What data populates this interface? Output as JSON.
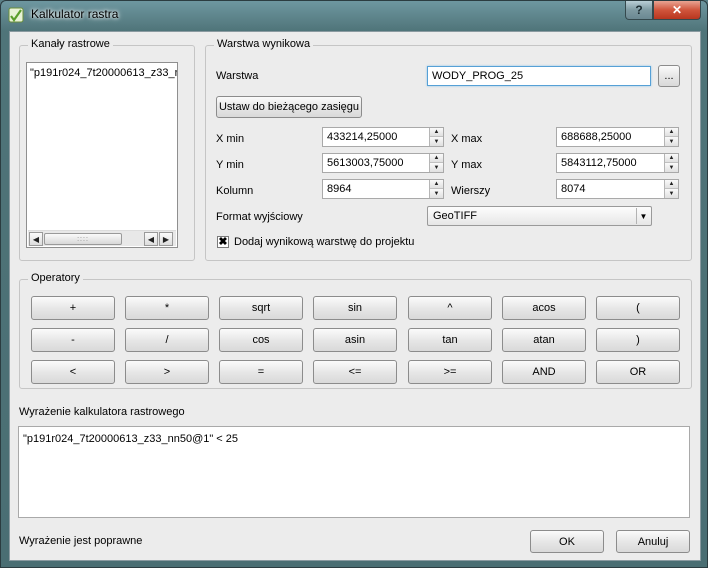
{
  "window": {
    "title": "Kalkulator rastra",
    "help_label": "?",
    "close_label": "✕"
  },
  "raster_bands": {
    "title": "Kanały rastrowe",
    "items": [
      "\"p191r024_7t20000613_z33_r"
    ]
  },
  "result_layer": {
    "title": "Warstwa wynikowa",
    "layer_label": "Warstwa",
    "layer_value": "WODY_PROG_25",
    "browse_label": "...",
    "extent_button": "Ustaw do bieżącego zasięgu",
    "xmin_label": "X min",
    "xmin_value": "433214,25000",
    "xmax_label": "X max",
    "xmax_value": "688688,25000",
    "ymin_label": "Y min",
    "ymin_value": "5613003,75000",
    "ymax_label": "Y max",
    "ymax_value": "5843112,75000",
    "columns_label": "Kolumn",
    "columns_value": "8964",
    "rows_label": "Wierszy",
    "rows_value": "8074",
    "format_label": "Format wyjściowy",
    "format_value": "GeoTIFF",
    "add_checkbox_label": "Dodaj wynikową warstwę do projektu",
    "add_checkbox_checked": true
  },
  "operators": {
    "title": "Operatory",
    "rows": [
      [
        "+",
        "*",
        "sqrt",
        "sin",
        "^",
        "acos",
        "("
      ],
      [
        "-",
        "/",
        "cos",
        "asin",
        "tan",
        "atan",
        ")"
      ],
      [
        "<",
        ">",
        "=",
        "<=",
        ">=",
        "AND",
        "OR"
      ]
    ]
  },
  "expression": {
    "label": "Wyrażenie kalkulatora rastrowego",
    "value": "\"p191r024_7t20000613_z33_nn50@1\" < 25"
  },
  "footer": {
    "status": "Wyrażenie jest poprawne",
    "ok_label": "OK",
    "cancel_label": "Anuluj"
  },
  "icons": {
    "app": "qgis-raster-calculator-icon",
    "spin_up": "arrow-up-icon",
    "spin_down": "arrow-down-icon",
    "combo": "chevron-down-icon",
    "scroll_left": "arrow-left-icon",
    "scroll_right": "arrow-right-icon"
  }
}
